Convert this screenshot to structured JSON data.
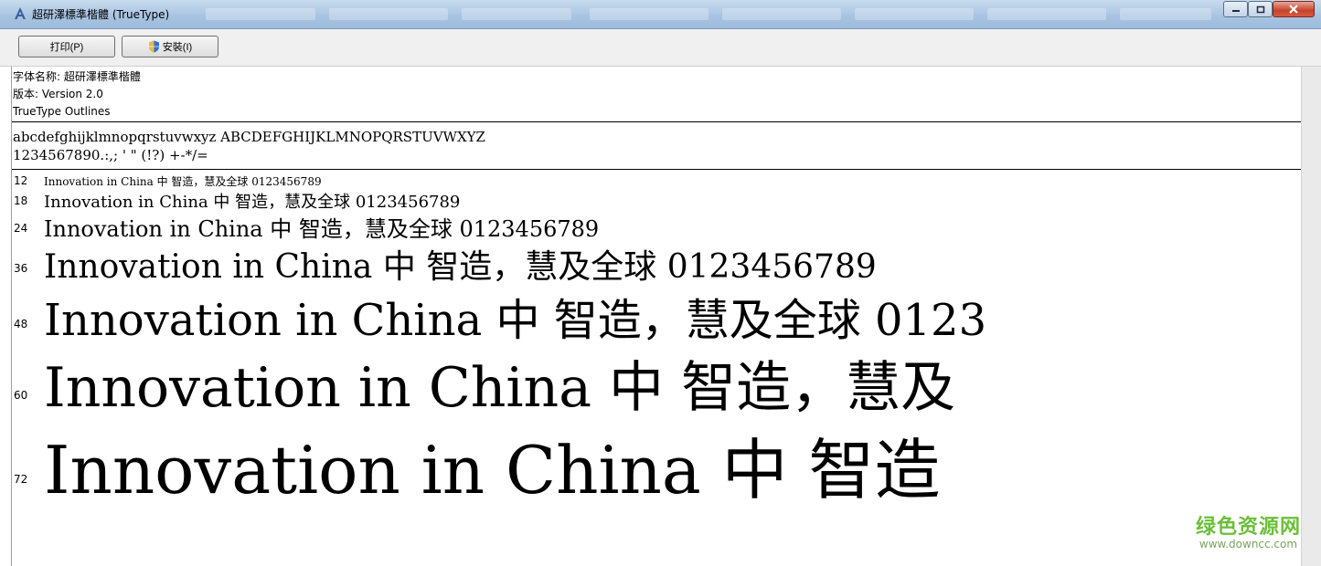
{
  "window": {
    "title": "超研澤標準楷體 (TrueType)"
  },
  "toolbar": {
    "print_label": "打印(P)",
    "install_label": "安裝(I)"
  },
  "font_info": {
    "name_line": "字体名称: 超研澤標準楷體",
    "version_line": "版本: Version 2.0",
    "outline_line": "TrueType Outlines"
  },
  "charset": {
    "line1": "abcdefghijklmnopqrstuvwxyz ABCDEFGHIJKLMNOPQRSTUVWXYZ",
    "line2": "1234567890.:,; ' \" (!?) +-*/="
  },
  "samples": [
    {
      "size": "12",
      "text": "Innovation in China 中  智造，慧及全球 0123456789"
    },
    {
      "size": "18",
      "text": "Innovation in China 中  智造，慧及全球 0123456789"
    },
    {
      "size": "24",
      "text": "Innovation in China 中  智造，慧及全球 0123456789"
    },
    {
      "size": "36",
      "text": "Innovation in China 中  智造，慧及全球 0123456789"
    },
    {
      "size": "48",
      "text": "Innovation in China 中  智造，慧及全球 0123"
    },
    {
      "size": "60",
      "text": "Innovation in China 中  智造，慧及"
    },
    {
      "size": "72",
      "text": "Innovation in China 中  智造"
    }
  ],
  "watermark": {
    "title": "绿色资源网",
    "url": "www.downcc.com"
  },
  "colors": {
    "titlebar": "#a9c4e2",
    "close_button": "#c7412c",
    "watermark_green": "#6cbf3a"
  }
}
